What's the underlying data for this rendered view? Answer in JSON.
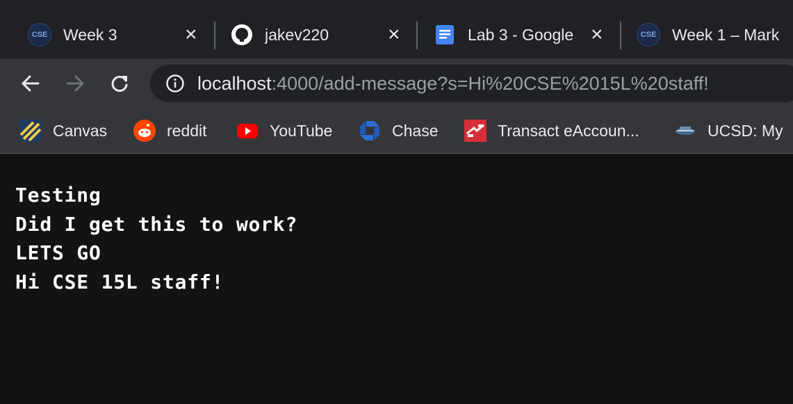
{
  "tabs": [
    {
      "title": "Week 3",
      "icon": "cse-icon",
      "icon_text": "CSE"
    },
    {
      "title": "jakev220",
      "icon": "github-icon"
    },
    {
      "title": "Lab 3 - Google",
      "icon": "google-docs-icon"
    },
    {
      "title": "Week 1 – Mark",
      "icon": "cse-icon",
      "icon_text": "CSE"
    }
  ],
  "toolbar": {
    "back_icon": "arrow-left-icon",
    "forward_icon": "arrow-right-icon",
    "reload_icon": "reload-icon"
  },
  "address_bar": {
    "host": "localhost",
    "rest": ":4000/add-message?s=Hi%20CSE%2015L%20staff!",
    "info_icon": "info-icon"
  },
  "bookmarks": [
    {
      "label": "Canvas",
      "icon": "canvas-icon"
    },
    {
      "label": "reddit",
      "icon": "reddit-icon"
    },
    {
      "label": "YouTube",
      "icon": "youtube-icon"
    },
    {
      "label": "Chase",
      "icon": "chase-icon"
    },
    {
      "label": "Transact eAccoun...",
      "icon": "transact-icon"
    },
    {
      "label": "UCSD: My",
      "icon": "ucsd-icon"
    }
  ],
  "page": {
    "messages": [
      "Testing",
      "Did I get this to work?",
      "LETS GO",
      "Hi CSE 15L staff!"
    ]
  },
  "colors": {
    "tab_strip": "#202124",
    "toolbar": "#35363a",
    "page_background": "#131313",
    "text": "#e8eaed"
  }
}
